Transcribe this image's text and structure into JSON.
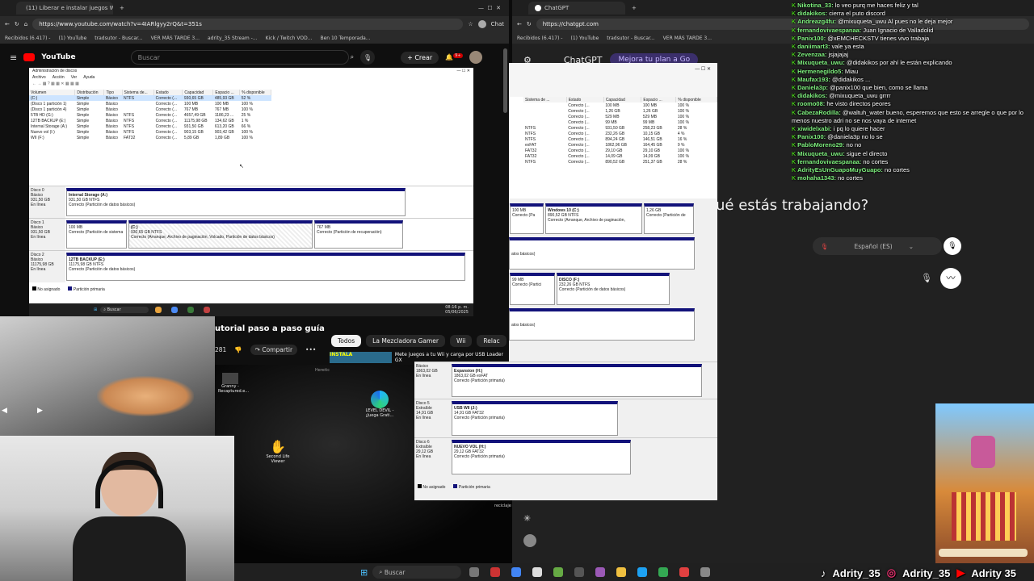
{
  "left_browser": {
    "tab_title": "(11) Liberar e instalar juegos Wii y",
    "url": "https://www.youtube.com/watch?v=4IARlgyy2rQ&t=351s",
    "bookmarks": [
      "Recibidos (6.417) -",
      "(1) YouTube",
      "tradsutor - Buscar...",
      "VER MÁS TARDE 3...",
      "adrity_35 Stream -...",
      "Kick / Twitch VOD...",
      "Ben 10 Temporada..."
    ],
    "chat_button": "Chat"
  },
  "youtube": {
    "logo": "YouTube",
    "search_placeholder": "Buscar",
    "create_label": "Crear",
    "notif_count": "9+",
    "video_title_partial": "utorial paso a paso guía",
    "likes": "281",
    "share_label": "Compartir",
    "chips": [
      "Todos",
      "La Mezcladora Gamer",
      "Wii",
      "Relac"
    ],
    "related_title": "Mete juegos a tu Wii y carga por USB Loader GX",
    "related_thumb_text": "INSTALA"
  },
  "disk_mgmt": {
    "title": "Administración de discos",
    "menu": [
      "Archivo",
      "Acción",
      "Ver",
      "Ayuda"
    ],
    "columns": [
      "Volumen",
      "Distribución",
      "Tipo",
      "Sistema de...",
      "Estado",
      "Capacidad",
      "Espacio ...",
      "% disponible"
    ],
    "rows": [
      [
        "(C:)",
        "Simple",
        "Básico",
        "NTFS",
        "Correcto (...",
        "930,65 GB",
        "485,93 GB",
        "52 %"
      ],
      [
        "(Disco 1 partición 1)",
        "Simple",
        "Básico",
        "",
        "Correcto (...",
        "100 MB",
        "100 MB",
        "100 %"
      ],
      [
        "(Disco 1 partición 4)",
        "Simple",
        "Básico",
        "",
        "Correcto (...",
        "767 MB",
        "767 MB",
        "100 %"
      ],
      [
        "5TB HD (G:)",
        "Simple",
        "Básico",
        "NTFS",
        "Correcto (...",
        "4657,49 GB",
        "1186,23 ...",
        "25 %"
      ],
      [
        "12TB BACKUP (E:)",
        "Simple",
        "Básico",
        "NTFS",
        "Correcto (...",
        "11175,98 GB",
        "134,62 GB",
        "1 %"
      ],
      [
        "Internal Storage (A:)",
        "Simple",
        "Básico",
        "NTFS",
        "Correcto (...",
        "931,50 GB",
        "613,20 GB",
        "66 %"
      ],
      [
        "Nuevo vol (I:)",
        "Simple",
        "Básico",
        "NTFS",
        "Correcto (...",
        "903,15 GB",
        "903,42 GB",
        "100 %"
      ],
      [
        "WII (F:)",
        "Simple",
        "Básico",
        "FAT32",
        "Correcto (...",
        "5,89 GB",
        "1,89 GB",
        "100 %"
      ]
    ],
    "disks": [
      {
        "label": "Disco 0",
        "type": "Básico",
        "size": "931,50 GB",
        "status": "En línea",
        "parts": [
          {
            "name": "Internal Storage (A:)",
            "detail": "931,50 GB NTFS",
            "state": "Correcto (Partición de datos básicos)"
          }
        ]
      },
      {
        "label": "Disco 1",
        "type": "Básico",
        "size": "931,50 GB",
        "status": "En línea",
        "parts": [
          {
            "name": "",
            "detail": "100 MB",
            "state": "Correcto (Partición de sistema"
          },
          {
            "name": "(C:)",
            "detail": "930,65 GB NTFS",
            "state": "Correcto (Arranque, Archivo de paginación, Volcado, Partición de datos básicos)"
          },
          {
            "name": "",
            "detail": "767 MB",
            "state": "Correcto (Partición de recuperación)"
          }
        ]
      },
      {
        "label": "Disco 2",
        "type": "Básico",
        "size": "11175,98 GB",
        "status": "En línea",
        "parts": [
          {
            "name": "12TB BACKUP (E:)",
            "detail": "11175,98 GB NTFS",
            "state": "Correcto (Partición de datos básicos)"
          }
        ]
      }
    ],
    "legend": [
      "No asignado",
      "Partición primaria"
    ],
    "taskbar_search": "Buscar",
    "time": "08:16 p. m.",
    "date": "05/06/2025"
  },
  "right_disk": {
    "columns": [
      "Sistema de ...",
      "Estado",
      "Capacidad",
      "Espacio ...",
      "% disponible"
    ],
    "rows": [
      [
        "",
        "Correcto (...",
        "100 MB",
        "100 MB",
        "100 %"
      ],
      [
        "",
        "Correcto (...",
        "1,26 GB",
        "1,26 GB",
        "100 %"
      ],
      [
        "",
        "Correcto (...",
        "529 MB",
        "529 MB",
        "100 %"
      ],
      [
        "",
        "Correcto (...",
        "99 MB",
        "99 MB",
        "100 %"
      ],
      [
        "NTFS",
        "Correcto (...",
        "931,50 GB",
        "258,23 GB",
        "28 %"
      ],
      [
        "NTFS",
        "Correcto (...",
        "232,26 GB",
        "10,15 GB",
        "4 %"
      ],
      [
        "NTFS",
        "Correcto (...",
        "894,24 GB",
        "146,51 GB",
        "16 %"
      ],
      [
        "exFAT",
        "Correcto (...",
        "1862,96 GB",
        "164,45 GB",
        "9 %"
      ],
      [
        "FAT32",
        "Correcto (...",
        "29,10 GB",
        "29,10 GB",
        "100 %"
      ],
      [
        "FAT32",
        "Correcto (...",
        "14,09 GB",
        "14,09 GB",
        "100 %"
      ],
      [
        "NTFS",
        "Correcto (...",
        "890,52 GB",
        "251,37 GB",
        "28 %"
      ]
    ],
    "part_a": {
      "c1": "100 MB",
      "c1b": "Correcto (Pa",
      "name": "Windows 10 (C:)",
      "detail": "890,52 GB NTFS",
      "state": "Correcto (Arranque, Archivo de paginación,",
      "c3": "1,26 GB",
      "c3b": "Correcto (Partición de"
    },
    "datos_basicos": "atos básicos)",
    "part_b": {
      "c1": "99 MB",
      "c1b": "Correcto (Partici",
      "name": "DISCO (F:)",
      "detail": "232,26 GB NTFS",
      "state": "Correcto (Partición de datos básicos)"
    },
    "disks_bottom": [
      {
        "label": "",
        "type": "Básico",
        "size": "1863,02 GB",
        "status": "En línea",
        "name": "Expansion (H:)",
        "detail": "1863,02 GB exFAT",
        "state": "Correcto (Partición primaria)"
      },
      {
        "label": "Disco 5",
        "type": "Extraíble",
        "size": "14,91 GB",
        "status": "En línea",
        "name": "USB WII (J:)",
        "detail": "14,91 GB FAT32",
        "state": "Correcto (Partición primaria)"
      },
      {
        "label": "Disco 6",
        "type": "Extraíble",
        "size": "29,12 GB",
        "status": "En línea",
        "name": "NUEVO VOL (H:)",
        "detail": "29,12 GB FAT32",
        "state": "Correcto (Partición primaria)"
      }
    ],
    "legend": [
      "No asignado",
      "Partición primaria"
    ]
  },
  "right_browser": {
    "tab_title": "ChatGPT",
    "url": "https://chatgpt.com",
    "chatgpt_title": "ChatGPT",
    "upgrade": "Mejora tu plan a Go",
    "question": "ué estás trabajando?",
    "language": "Español (ES)"
  },
  "desktop": {
    "icons": [
      "Granny - Recaptured.e...",
      "LEVEL DEVIL - ¡Juega Grati...",
      "Second Life Viewer",
      "reciclaje"
    ],
    "heretic": "Heretic"
  },
  "taskbar": {
    "search": "Buscar"
  },
  "chat": [
    {
      "user": "Nikotina_33:",
      "msg": "lo veo purq me haces feliz y tal"
    },
    {
      "user": "didakikos:",
      "msg": "cierra el puto discord"
    },
    {
      "user": "Andreazg4fu:",
      "msg": "@mixuqueta_uwu Al pues no le deja mejor"
    },
    {
      "user": "fernandovivaespanaa:",
      "msg": "Juan Ignacio de Valladolid"
    },
    {
      "user": "Panix100:",
      "msg": "@xEMCHECKSTV tienes vivo trabaja"
    },
    {
      "user": "daniimart3:",
      "msg": "vale ya esta"
    },
    {
      "user": "Zevenzaa:",
      "msg": "jsjajajaj"
    },
    {
      "user": "Mixuqueta_uwu:",
      "msg": "@didakikos por ahí le están explicando"
    },
    {
      "user": "Hermenegildo5:",
      "msg": "Miau"
    },
    {
      "user": "Maufax193:",
      "msg": "@didakikos ..."
    },
    {
      "user": "Daniela3p:",
      "msg": "@panix100 que bien, como se llama"
    },
    {
      "user": "didakikos:",
      "msg": "@mixuqueta_uwu grrrr"
    },
    {
      "user": "roomo08:",
      "msg": "he visto directos peores"
    },
    {
      "user": "CabezaRodilla:",
      "msg": "@waltuh_water bueno, esperemos que esto se arregle o que por lo menos nuestro adri no se nos vaya de internet"
    },
    {
      "user": "xiwidelxabi:",
      "msg": "i pq lo quiere hacer"
    },
    {
      "user": "Panix100:",
      "msg": "@daniela3p no lo se"
    },
    {
      "user": "PabloMoreno29:",
      "msg": "no no"
    },
    {
      "user": "Mixuqueta_uwu:",
      "msg": "sigue el directo"
    },
    {
      "user": "fernandovivaespanaa:",
      "msg": "no cortes"
    },
    {
      "user": "AdrityEsUnGuapoMuyGuapo:",
      "msg": "no cortes"
    },
    {
      "user": "mohaha1343:",
      "msg": "no cortes"
    }
  ],
  "socials": [
    "Adrity_35",
    "Adrity_35",
    "Adrity 35"
  ]
}
